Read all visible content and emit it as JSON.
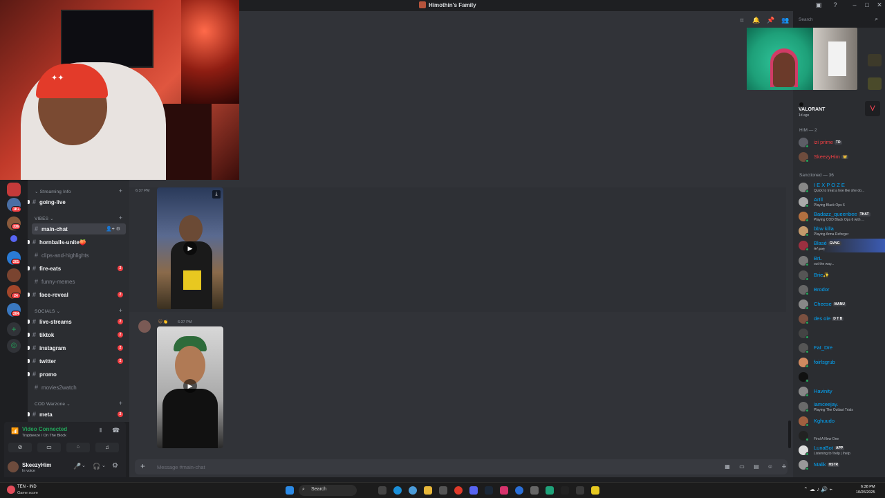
{
  "window": {
    "title": "Himothin's Family"
  },
  "search": {
    "placeholder": "Search"
  },
  "servers": [
    {
      "badge": "1K+",
      "color": "#4a6fa5"
    },
    {
      "badge": "336",
      "color": "#8a5a3c"
    },
    {
      "badge": "",
      "color": "#5865f2"
    },
    {
      "badge": "201",
      "color": "#2a7bd5"
    },
    {
      "badge": "",
      "color": "#7a4430"
    },
    {
      "badge": "24",
      "color": "#a3462a"
    },
    {
      "badge": "204",
      "color": "#3a78c0"
    }
  ],
  "channels": {
    "categories": {
      "streaming_info": "Streaming Info",
      "vibes": "VIBES",
      "socials": "SOCIALS",
      "cod": "COD Warzone"
    },
    "items": [
      {
        "name": "going-live"
      },
      {
        "name": "main-chat"
      },
      {
        "name": "hornballs-unite",
        "emoji": "🍑"
      },
      {
        "name": "clips-and-highlights"
      },
      {
        "name": "fire-eats",
        "mentions": "2"
      },
      {
        "name": "funny-memes"
      },
      {
        "name": "face-reveal",
        "mentions": "2"
      },
      {
        "name": "live-streams",
        "mentions": "2"
      },
      {
        "name": "tiktok",
        "mentions": "2"
      },
      {
        "name": "instagram",
        "mentions": "2"
      },
      {
        "name": "twitter",
        "mentions": "2"
      },
      {
        "name": "promo"
      },
      {
        "name": "movies2watch"
      },
      {
        "name": "meta",
        "mentions": "2"
      }
    ]
  },
  "voice": {
    "status": "Video Connected",
    "location": "Trapbeeze / On The Block"
  },
  "user": {
    "name": "SkeezyHim",
    "state": "In voice"
  },
  "messages": [
    {
      "time": "6:37 PM"
    },
    {
      "time": "6:37 PM"
    }
  ],
  "composer": {
    "placeholder": "Message #main-chat"
  },
  "members": {
    "game": {
      "name": "VALORANT",
      "ago": "1d ago"
    },
    "groups": [
      {
        "title": "HIM — 2"
      },
      {
        "title": "Sanctioned — 36"
      }
    ],
    "him": [
      {
        "name": "izi prime",
        "tag": "TD",
        "color": "#f23f43",
        "avatar": "#5c5e66"
      },
      {
        "name": "SkeezyHim",
        "tag": "👑",
        "color": "#f23f43",
        "avatar": "#6e4c3d"
      }
    ],
    "sanctioned": [
      {
        "name": "I E X P O Z E",
        "activity": "Quick to treat a hoe like she do...",
        "avatar": "#888"
      },
      {
        "name": "ArIll",
        "activity": "Playing Black Ops 6",
        "avatar": "#aaa"
      },
      {
        "name": "Badazz_queenbee",
        "tag": "THAT",
        "activity": "Playing COD Black Ops 6 with ...",
        "avatar": "#b27040"
      },
      {
        "name": "bbw killa",
        "activity": "Playing Arma Reforger",
        "avatar": "#c49a6c"
      },
      {
        "name": "Blasé",
        "tag": "GVNG",
        "activity": "𝓁𝑒𝓉 𝑔𝑜𝒹𝓏",
        "avatar": "#9a3040",
        "highlight": true
      },
      {
        "name": "BrL",
        "activity": "out the way...",
        "avatar": "#777"
      },
      {
        "name": "Brie✨",
        "activity": "",
        "avatar": "#555"
      },
      {
        "name": "Brodor",
        "activity": "",
        "avatar": "#666"
      },
      {
        "name": "Cheese",
        "tag": "MANU",
        "activity": "",
        "avatar": "#888"
      },
      {
        "name": "des ole",
        "tag": "D T B",
        "activity": "",
        "avatar": "#7a5040"
      },
      {
        "name": "",
        "activity": "",
        "avatar": "#444"
      },
      {
        "name": "Fat_Dre",
        "activity": "",
        "avatar": "#555"
      },
      {
        "name": "foirlsgrub",
        "activity": "",
        "avatar": "#d08a60"
      },
      {
        "name": "",
        "activity": "",
        "avatar": "#111"
      },
      {
        "name": "Havinity",
        "activity": "",
        "avatar": "#888"
      },
      {
        "name": "iamceejay.",
        "activity": "Playing The Outlast Trials",
        "avatar": "#6a6a6a"
      },
      {
        "name": "Kghuudo",
        "activity": "",
        "avatar": "#a06040"
      },
      {
        "name": "",
        "activity": "Find A New One",
        "avatar": "#222"
      },
      {
        "name": "LunaBot",
        "tag": "APP",
        "activity": "Listening to !help | /help",
        "avatar": "#ddd"
      },
      {
        "name": "Malik",
        "tag": "HSTR",
        "activity": "",
        "avatar": "#999"
      }
    ]
  },
  "taskbar": {
    "weather_title": "TEN - IND",
    "weather_sub": "Game score",
    "search": "Search",
    "time": "6:38 PM",
    "date": "10/26/2025"
  },
  "colors": {
    "accent": "#5865f2",
    "online": "#23a55a",
    "mention": "#f23f43",
    "member_name": "#00a8fc"
  }
}
